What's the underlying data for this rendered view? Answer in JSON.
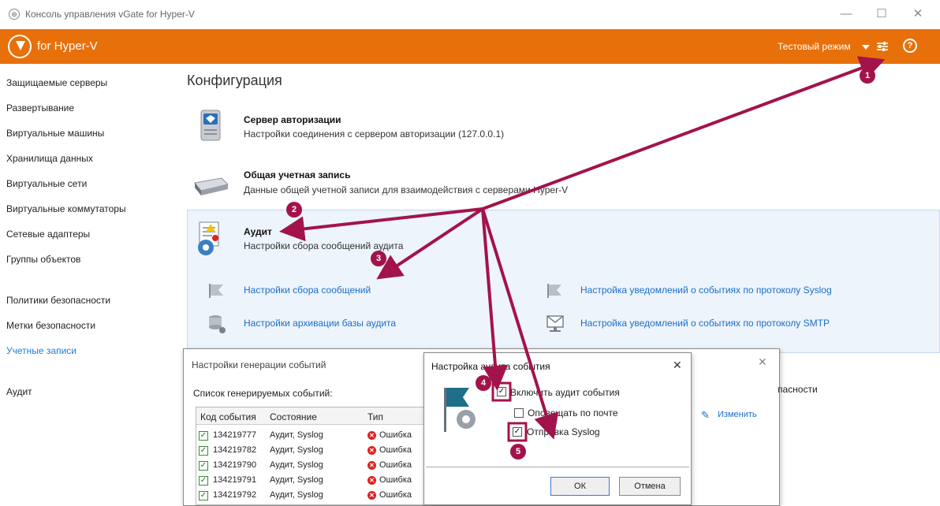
{
  "window": {
    "title": "Консоль управления vGate for Hyper-V",
    "min": "—",
    "max": "☐",
    "close": "✕"
  },
  "header": {
    "brand": "for Hyper-V",
    "mode": "Тестовый режим",
    "help": "?"
  },
  "sidebar": {
    "items": [
      "Защищаемые серверы",
      "Развертывание",
      "Виртуальные машины",
      "Хранилища данных",
      "Виртуальные сети",
      "Виртуальные коммутаторы",
      "Сетевые адаптеры",
      "Группы объектов",
      "Политики безопасности",
      "Метки безопасности",
      "Учетные записи",
      "Аудит"
    ]
  },
  "main": {
    "title": "Конфигурация",
    "sections": [
      {
        "title": "Сервер авторизации",
        "desc": "Настройки соединения с сервером авторизации (127.0.0.1)"
      },
      {
        "title": "Общая учетная запись",
        "desc": "Данные общей учетной записи для взаимодействия с серверами Hyper-V"
      },
      {
        "title": "Аудит",
        "desc": "Настройки сбора сообщений аудита"
      }
    ],
    "links": [
      "Настройки сбора сообщений",
      "Настройки архивации базы аудита",
      "Настройка уведомлений о событиях по протоколу Syslog",
      "Настройка уведомлений о событиях по протоколу SMTP"
    ],
    "partial_text": "пасности",
    "edit_label": "Изменить"
  },
  "events_dialog": {
    "title": "Настройки генерации событий",
    "list_label": "Список генерируемых событий:",
    "columns": [
      "Код события",
      "Состояние",
      "Тип"
    ],
    "rows": [
      {
        "code": "134219777",
        "state": "Аудит, Syslog",
        "type": "Ошибка"
      },
      {
        "code": "134219782",
        "state": "Аудит, Syslog",
        "type": "Ошибка"
      },
      {
        "code": "134219790",
        "state": "Аудит, Syslog",
        "type": "Ошибка"
      },
      {
        "code": "134219791",
        "state": "Аудит, Syslog",
        "type": "Ошибка"
      },
      {
        "code": "134219792",
        "state": "Аудит, Syslog",
        "type": "Ошибка"
      }
    ]
  },
  "audit_dialog": {
    "title": "Настройка аудита события",
    "close": "✕",
    "options": [
      {
        "label": "Включить аудит события",
        "checked": true
      },
      {
        "label": "Оповещать по почте",
        "checked": false
      },
      {
        "label": "Отправка Syslog",
        "checked": true
      }
    ],
    "ok": "ОК",
    "cancel": "Отмена"
  },
  "markers": [
    "1",
    "2",
    "3",
    "4",
    "5"
  ],
  "colors": {
    "accent": "#e8700b",
    "annotation": "#a3134b",
    "link": "#1a6ec6"
  }
}
